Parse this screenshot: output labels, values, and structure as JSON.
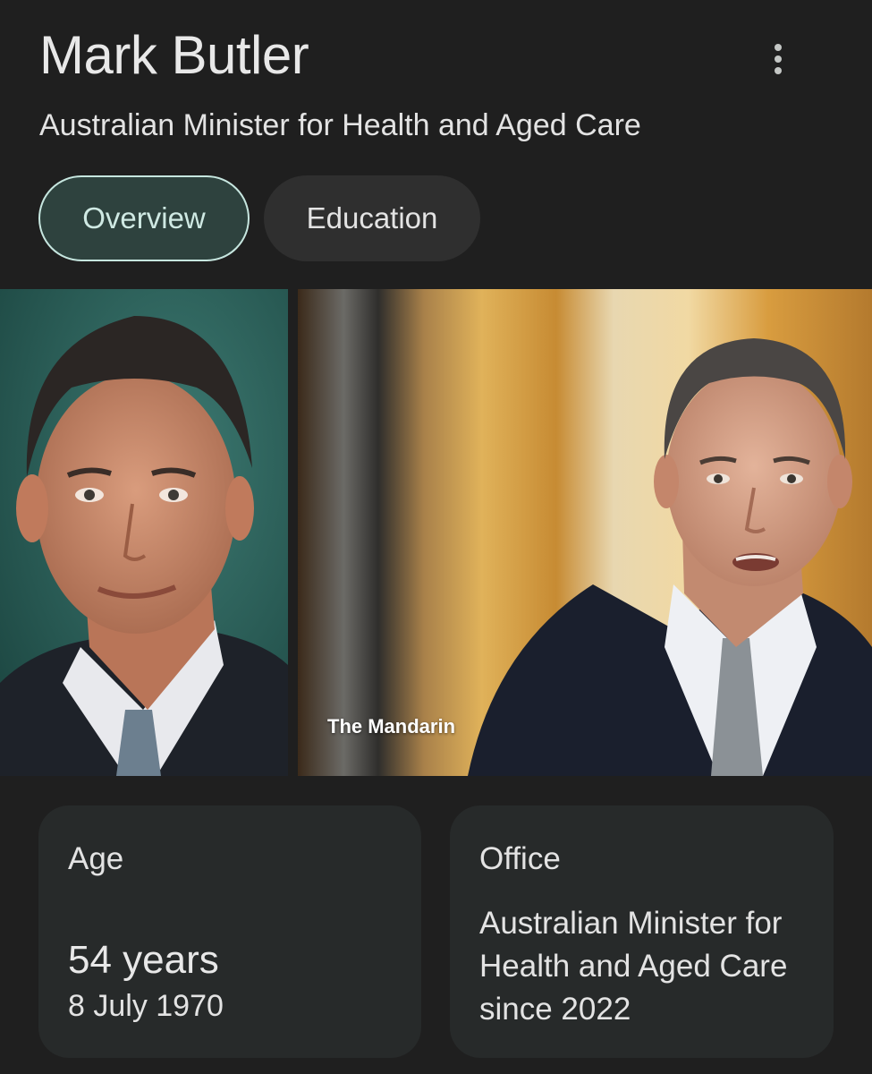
{
  "header": {
    "name": "Mark Butler",
    "subtitle": "Australian Minister for Health and Aged Care",
    "menu_icon": "more-vert-icon"
  },
  "tabs": [
    {
      "label": "Overview",
      "selected": true
    },
    {
      "label": "Education",
      "selected": false
    }
  ],
  "images": [
    {
      "source": ""
    },
    {
      "source": "The Mandarin"
    }
  ],
  "cards": {
    "age": {
      "label": "Age",
      "value": "54 years",
      "detail": "8 July 1970"
    },
    "office": {
      "label": "Office",
      "value": "Australian Minister for Health and Aged Care since 2022"
    }
  },
  "colors": {
    "background": "#1f1f1f",
    "card": "#272a2a",
    "selected_tab_bg": "#2e423e",
    "selected_tab_border": "#c6e6df",
    "tab_bg": "#2f2f2f"
  }
}
